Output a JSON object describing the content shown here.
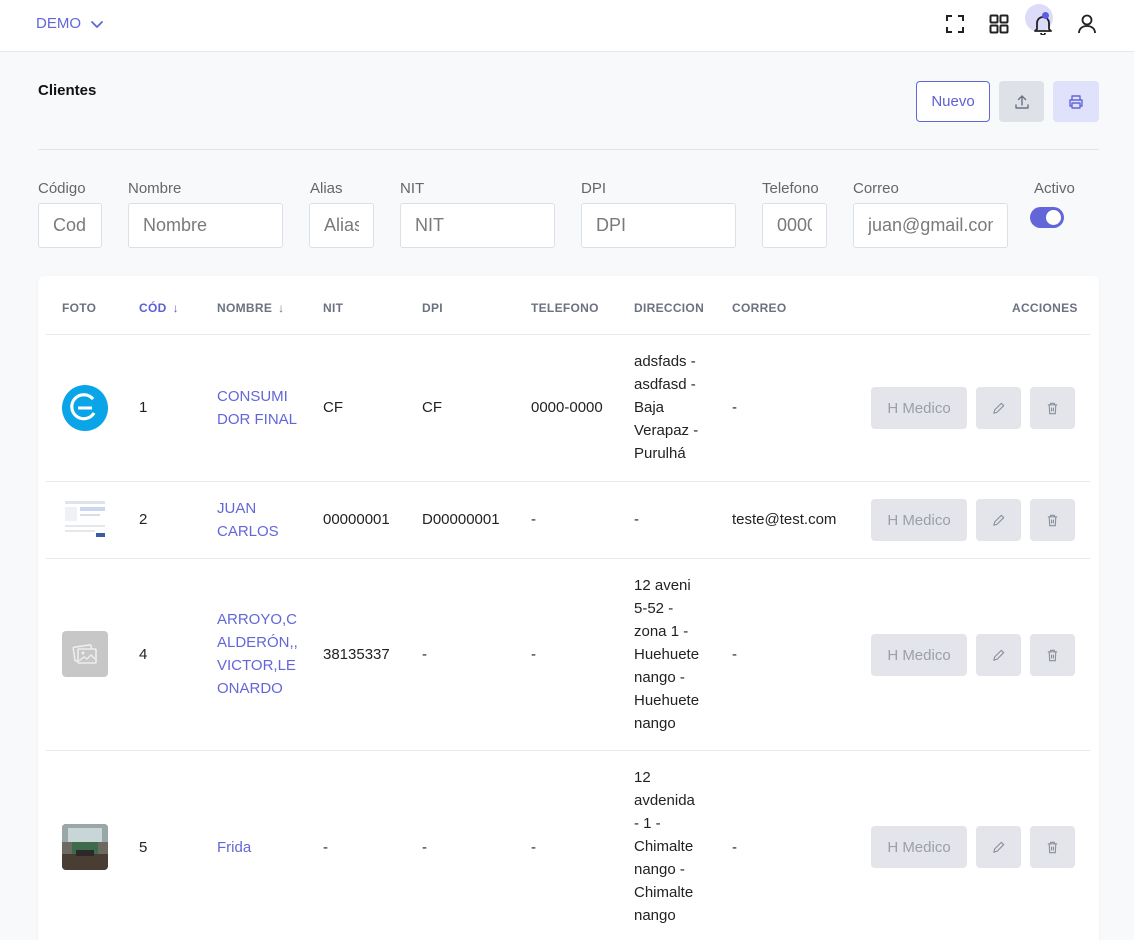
{
  "topbar": {
    "org_label": "DEMO",
    "icons": [
      "fullscreen-icon",
      "apps-grid-icon",
      "bell-icon",
      "user-icon"
    ]
  },
  "page": {
    "title": "Clientes",
    "new_button": "Nuevo"
  },
  "filters": {
    "codigo": {
      "label": "Código",
      "placeholder": "Cod"
    },
    "nombre": {
      "label": "Nombre",
      "placeholder": "Nombre"
    },
    "alias": {
      "label": "Alias",
      "placeholder": "Alias"
    },
    "nit": {
      "label": "NIT",
      "placeholder": "NIT"
    },
    "dpi": {
      "label": "DPI",
      "placeholder": "DPI"
    },
    "telefono": {
      "label": "Telefono",
      "placeholder": "0000-0000"
    },
    "correo": {
      "label": "Correo",
      "placeholder": "juan@gmail.com"
    },
    "activo": {
      "label": "Activo",
      "value": true
    }
  },
  "table": {
    "headers": {
      "foto": "FOTO",
      "cod": "CÓD",
      "nombre": "NOMBRE",
      "nit": "NIT",
      "dpi": "DPI",
      "telefono": "TELEFONO",
      "direccion": "DIRECCION",
      "correo": "CORREO",
      "acciones": "ACCIONES"
    },
    "sort_arrow": "↓",
    "action_label": "H Medico",
    "rows": [
      {
        "cod": "1",
        "nombre": "CONSUMI\nDOR FINAL",
        "nit": "CF",
        "dpi": "CF",
        "telefono": "0000-0000",
        "direccion": "adsfads -\nasdfasd -\nBaja\nVerapaz -\nPurulhá",
        "correo": "-"
      },
      {
        "cod": "2",
        "nombre": "JUAN\nCARLOS",
        "nit": "00000001",
        "dpi": "D00000001",
        "telefono": "-",
        "direccion": "-",
        "correo": "teste@test.com"
      },
      {
        "cod": "4",
        "nombre": "ARROYO,C\nALDERÓN,,\nVICTOR,LE\nONARDO",
        "nit": "38135337",
        "dpi": "-",
        "telefono": "-",
        "direccion": "12 aveni\n5-52 -\nzona 1 -\nHuehuete\nnango -\nHuehuete\nnango",
        "correo": "-"
      },
      {
        "cod": "5",
        "nombre": "Frida",
        "nit": "-",
        "dpi": "-",
        "telefono": "-",
        "direccion": "12\navdenida\n- 1 -\nChimalte\nnango -\nChimalte\nnango",
        "correo": "-"
      }
    ]
  }
}
